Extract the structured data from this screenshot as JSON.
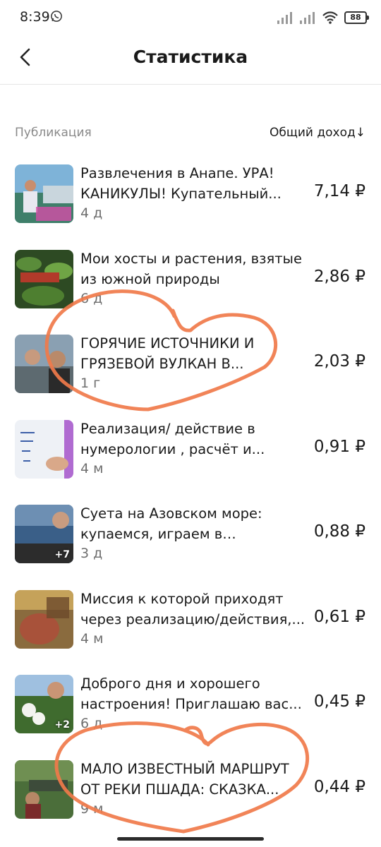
{
  "status_bar": {
    "time": "8:39",
    "battery": "88"
  },
  "header": {
    "title": "Статистика"
  },
  "columns": {
    "left": "Публикация",
    "right": "Общий доход↓"
  },
  "items": [
    {
      "title": "Развлечения в Анапе. УРА! КАНИКУЛЫ! Купательный...",
      "age": "4 д",
      "income": "7,14 ₽",
      "badge": ""
    },
    {
      "title": "Мои хосты и растения, взятые из южной природы",
      "age": "6 д",
      "income": "2,86 ₽",
      "badge": ""
    },
    {
      "title": "ГОРЯЧИЕ ИСТОЧНИКИ И ГРЯЗЕВОЙ ВУЛКАН В...",
      "age": "1 г",
      "income": "2,03 ₽",
      "badge": ""
    },
    {
      "title": "Реализация/ действие в нумерологии , расчёт и...",
      "age": "4 м",
      "income": "0,91 ₽",
      "badge": ""
    },
    {
      "title": "Суета на Азовском море: купаемся, играем в бадминто...",
      "age": "3 д",
      "income": "0,88 ₽",
      "badge": "+7"
    },
    {
      "title": "Миссия к которой приходят через реализацию/действия,...",
      "age": "4 м",
      "income": "0,61 ₽",
      "badge": ""
    },
    {
      "title": "Доброго дня и хорошего настроения! Приглашаю вас...",
      "age": "6 д",
      "income": "0,45 ₽",
      "badge": "+2"
    },
    {
      "title": "МАЛО ИЗВЕСТНЫЙ МАРШРУТ ОТ РЕКИ ПШАДА: СКАЗКА...",
      "age": "9 м",
      "income": "0,44 ₽",
      "badge": ""
    }
  ],
  "colors": {
    "scribble": "#f07a4a",
    "text": "#1a1a1a",
    "muted": "#8a8a8a"
  }
}
